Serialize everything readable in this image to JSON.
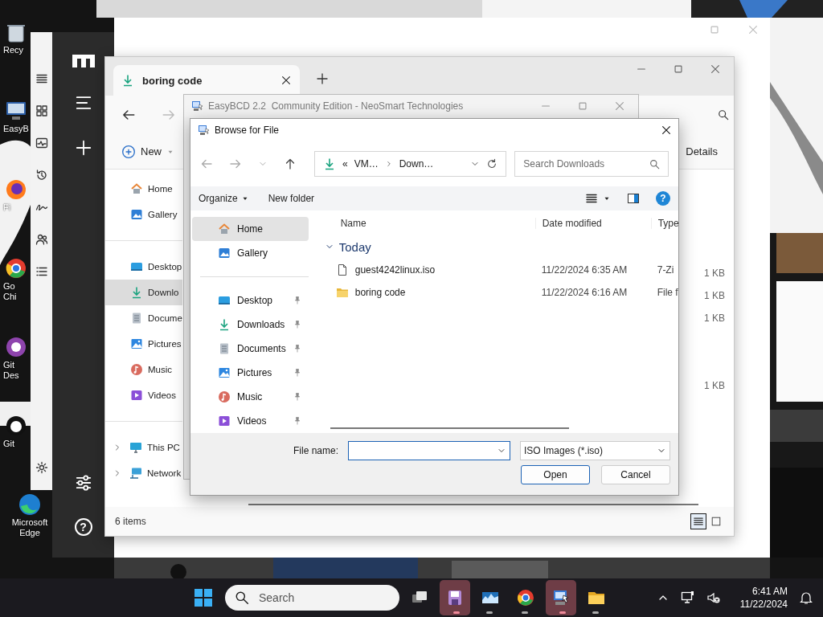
{
  "desktop_icons": [
    {
      "label": "Recy",
      "kind": "bin"
    },
    {
      "label": "EasyB",
      "kind": "screen"
    },
    {
      "label": "Fi",
      "kind": "flame"
    },
    {
      "label": "Go Chi",
      "kind": "wheel"
    },
    {
      "label": "Git Des",
      "kind": "ring"
    },
    {
      "label": "Git",
      "kind": "cat"
    },
    {
      "label": "Microsoft Edge",
      "kind": "swirl"
    }
  ],
  "side_app": {
    "help_glyph": "?"
  },
  "explorer": {
    "tabs": [
      {
        "label": "boring code",
        "selected": true
      }
    ],
    "new_label": "New",
    "details_label": "Details",
    "nav_sections": [
      [
        {
          "label": "Home",
          "kind": "home",
          "selected": false
        },
        {
          "label": "Gallery",
          "kind": "gallery",
          "selected": false
        }
      ],
      [
        {
          "label": "Desktop",
          "kind": "desktop",
          "selected": false
        },
        {
          "label": "Downlo",
          "kind": "download",
          "selected": true
        },
        {
          "label": "Docume",
          "kind": "documents",
          "selected": false
        },
        {
          "label": "Pictures",
          "kind": "pictures",
          "selected": false
        },
        {
          "label": "Music",
          "kind": "music",
          "selected": false
        },
        {
          "label": "Videos",
          "kind": "videos",
          "selected": false
        }
      ],
      [
        {
          "label": "This PC",
          "kind": "pc",
          "selected": false,
          "expanded": false
        },
        {
          "label": "Network",
          "kind": "network",
          "selected": false,
          "expanded": false
        }
      ]
    ],
    "rows": [
      {
        "kind": "file",
        "size": "1 KB"
      },
      {
        "kind": "file",
        "size": "1 KB"
      },
      {
        "kind": "file",
        "size": "1 KB"
      },
      {
        "kind": "folder"
      },
      {
        "kind": "folder"
      },
      {
        "kind": "file",
        "size": "1 KB"
      }
    ],
    "status": "6 items",
    "views": [
      {
        "kind": "details",
        "selected": true
      },
      {
        "kind": "tiles",
        "selected": false
      }
    ]
  },
  "easybcd": {
    "title": "EasyBCD 2.2  Community Edition - NeoSmart Technologies"
  },
  "dialog": {
    "title": "Browse for File",
    "overflow_glyph": "«",
    "path": [
      "VM…",
      "Down…"
    ],
    "search": {
      "placeholder": "Search Downloads"
    },
    "organize": "Organize",
    "new_folder": "New folder",
    "help_glyph": "?",
    "nav_sections": [
      [
        {
          "label": "Home",
          "kind": "home",
          "selected": true,
          "pinned": false
        },
        {
          "label": "Gallery",
          "kind": "gallery",
          "selected": false,
          "pinned": false
        }
      ],
      [
        {
          "label": "Desktop",
          "kind": "desktop",
          "selected": false,
          "pinned": true
        },
        {
          "label": "Downloads",
          "kind": "download",
          "selected": false,
          "pinned": true
        },
        {
          "label": "Documents",
          "kind": "documents",
          "selected": false,
          "pinned": true
        },
        {
          "label": "Pictures",
          "kind": "pictures",
          "selected": false,
          "pinned": true
        },
        {
          "label": "Music",
          "kind": "music",
          "selected": false,
          "pinned": true
        },
        {
          "label": "Videos",
          "kind": "videos",
          "selected": false,
          "pinned": true
        }
      ]
    ],
    "columns": [
      "Name",
      "Date modified",
      "Type"
    ],
    "groups": [
      {
        "label": "Today",
        "expanded": true,
        "files": [
          {
            "name": "guest4242linux.iso",
            "kind": "file",
            "date": "11/22/2024 6:35 AM",
            "type": "7-Zi"
          },
          {
            "name": "boring code",
            "kind": "folder",
            "date": "11/22/2024 6:16 AM",
            "type": "File f"
          }
        ]
      }
    ],
    "file_name_label": "File name:",
    "filter": "ISO Images (*.iso)",
    "buttons": [
      {
        "label": "Open",
        "default": true
      },
      {
        "label": "Cancel",
        "default": false
      }
    ]
  },
  "taskbar": {
    "search": {
      "placeholder": "Search"
    },
    "apps": [
      {
        "kind": "taskview",
        "running": false,
        "highlighted": false
      },
      {
        "kind": "floppy",
        "running": true,
        "highlighted": true
      },
      {
        "kind": "landscape",
        "running": true,
        "highlighted": false
      },
      {
        "kind": "wheel",
        "running": true,
        "highlighted": false
      },
      {
        "kind": "computer",
        "running": true,
        "highlighted": true
      },
      {
        "kind": "folder",
        "running": true,
        "highlighted": false
      }
    ],
    "time": "6:41 AM",
    "date": "11/22/2024"
  }
}
